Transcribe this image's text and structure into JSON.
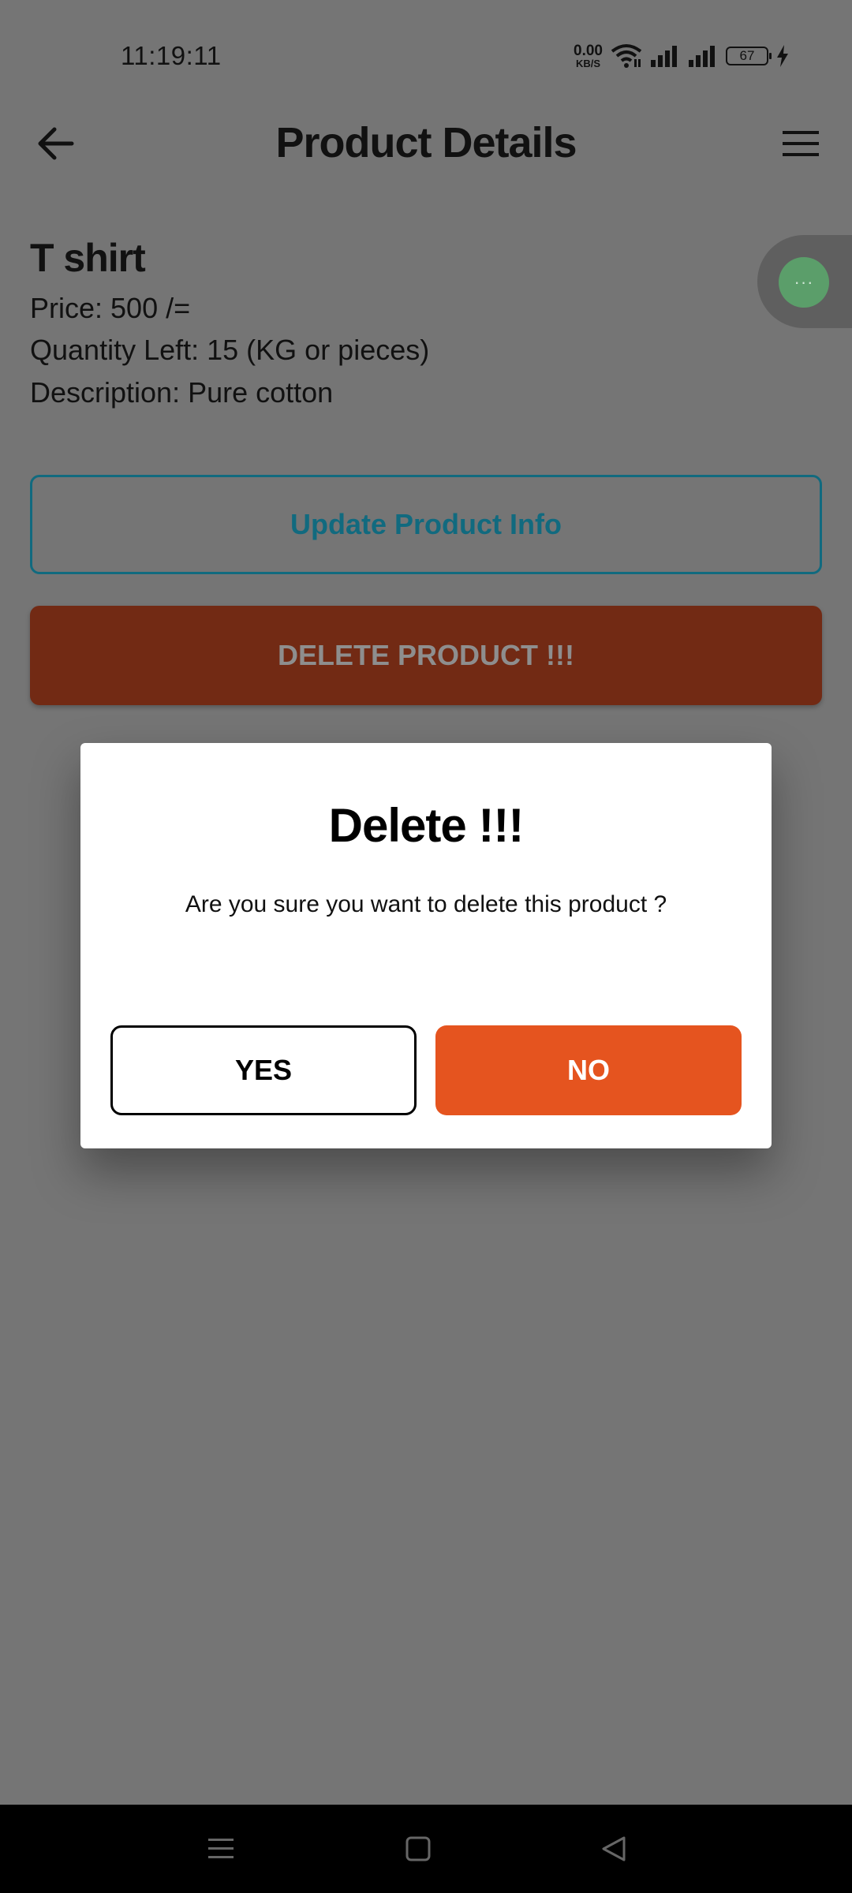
{
  "status_bar": {
    "time": "11:19:11",
    "net_speed_value": "0.00",
    "net_speed_unit": "KB/S",
    "battery_level": "67"
  },
  "app_bar": {
    "title": "Product Details"
  },
  "product": {
    "name": "T shirt",
    "price": "Price: 500 /=",
    "quantity": "Quantity Left: 15 (KG or pieces)",
    "description": "Description: Pure cotton"
  },
  "actions": {
    "update_label": "Update Product Info",
    "delete_label": "DELETE PRODUCT !!!"
  },
  "dialog": {
    "title": "Delete !!!",
    "message": "Are you sure you want to delete this product ?",
    "yes_label": "YES",
    "no_label": "NO"
  },
  "colors": {
    "overlay": "#757575",
    "accent_teal": "#116a7f",
    "danger_dark": "#722a14",
    "danger": "#e5541f"
  }
}
